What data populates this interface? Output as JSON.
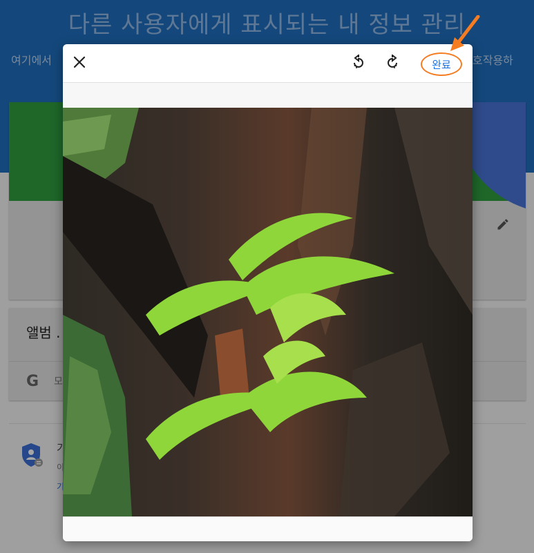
{
  "page": {
    "title": "다른 사용자에게 표시되는 내 정보 관리",
    "subtitle_left": "여기에서",
    "subtitle_right": "호작용하"
  },
  "profile_card": {
    "edit_icon": "pencil-icon"
  },
  "album_card": {
    "label": "앨범 .",
    "google_icon": "google-g-icon",
    "google_text": "모"
  },
  "security_section": {
    "icon": "shield-user-icon",
    "line1": "기",
    "line2": "이",
    "link": "기"
  },
  "editor_modal": {
    "close_icon": "close-icon",
    "rotate_left_icon": "rotate-left-icon",
    "rotate_right_icon": "rotate-right-icon",
    "done_label": "완료",
    "image_subject": "fern-on-tree-bark-photo"
  },
  "colors": {
    "header_blue": "#1f6fbf",
    "accent_green": "#2e9e3f",
    "link_blue": "#1a73e8",
    "annotation_orange": "#f57c20"
  }
}
